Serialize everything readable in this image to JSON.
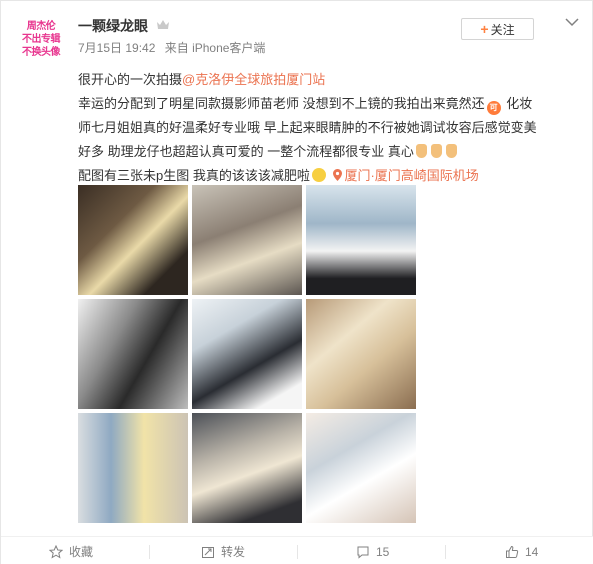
{
  "avatar": {
    "lines": [
      "周杰伦",
      "不出专辑",
      "不换头像"
    ]
  },
  "user": {
    "name": "一颗绿龙眼"
  },
  "meta": {
    "date": "7月15日 19:42",
    "source": "来自 iPhone客户端"
  },
  "follow": {
    "label": "关注",
    "plus": "+"
  },
  "post": {
    "line1_text": "很开心的一次拍摄",
    "line1_link": "@克洛伊全球旅拍厦门站",
    "line2_text": "幸运的分配到了明星同款摄影师苗老师 没想到不上镜的我拍出来竟然还",
    "line2_emoji": "可",
    "line2_tail": " 化妆",
    "line3_text": "师七月姐姐真的好温柔好专业哦 早上起来眼睛肿的不行被她调试妆容后感觉变美",
    "line4_text": "好多 助理龙仔也超超认真可爱的 一整个流程都很专业 真心",
    "line5_text": "配图有三张未p生图 我真的该该该减肥啦",
    "line5_location": "厦门·厦门高崎国际机场"
  },
  "actions": {
    "favorite": "收藏",
    "repost": "转发",
    "comments": "15",
    "likes": "14"
  },
  "icons": [
    "crown-icon",
    "chevron-down-icon",
    "star-icon",
    "repost-icon",
    "comment-icon",
    "like-icon",
    "location-pin-icon"
  ],
  "colors": {
    "link": "#eb7350",
    "plus": "#ff8140",
    "meta": "#808080",
    "avatar_text": "#e8368f"
  }
}
